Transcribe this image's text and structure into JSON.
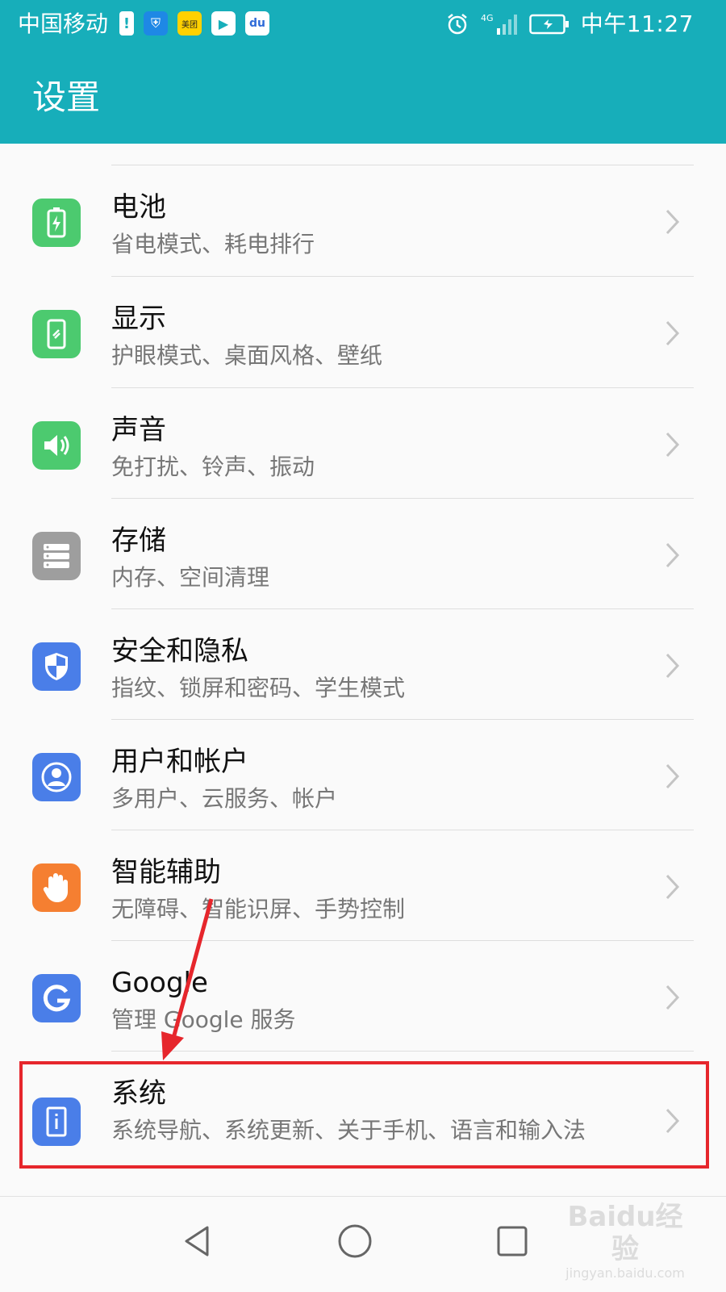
{
  "status_bar": {
    "carrier": "中国移动",
    "network": "4G",
    "time": "中午11:27",
    "meituan_label": "美团"
  },
  "app_bar": {
    "title": "设置"
  },
  "items": [
    {
      "title": "电池",
      "subtitle": "省电模式、耗电排行",
      "icon": "battery-icon",
      "color": "#4cca6f"
    },
    {
      "title": "显示",
      "subtitle": "护眼模式、桌面风格、壁纸",
      "icon": "display-icon",
      "color": "#4cca6f"
    },
    {
      "title": "声音",
      "subtitle": "免打扰、铃声、振动",
      "icon": "speaker-icon",
      "color": "#4cca6f"
    },
    {
      "title": "存储",
      "subtitle": "内存、空间清理",
      "icon": "storage-icon",
      "color": "#9e9e9e"
    },
    {
      "title": "安全和隐私",
      "subtitle": "指纹、锁屏和密码、学生模式",
      "icon": "shield-icon",
      "color": "#4a7ee8"
    },
    {
      "title": "用户和帐户",
      "subtitle": "多用户、云服务、帐户",
      "icon": "user-icon",
      "color": "#4a7ee8"
    },
    {
      "title": "智能辅助",
      "subtitle": "无障碍、智能识屏、手势控制",
      "icon": "hand-icon",
      "color": "#f57f31"
    },
    {
      "title": "Google",
      "subtitle": "管理 Google 服务",
      "icon": "google-icon",
      "color": "#4a7ee8"
    },
    {
      "title": "系统",
      "subtitle": "系统导航、系统更新、关于手机、语言和输入法",
      "icon": "system-info-icon",
      "color": "#4a7ee8"
    }
  ],
  "watermark": {
    "logo": "Baidu经验",
    "url": "jingyan.baidu.com"
  },
  "colors": {
    "accent": "#17aeba",
    "highlight": "#e6262c"
  }
}
